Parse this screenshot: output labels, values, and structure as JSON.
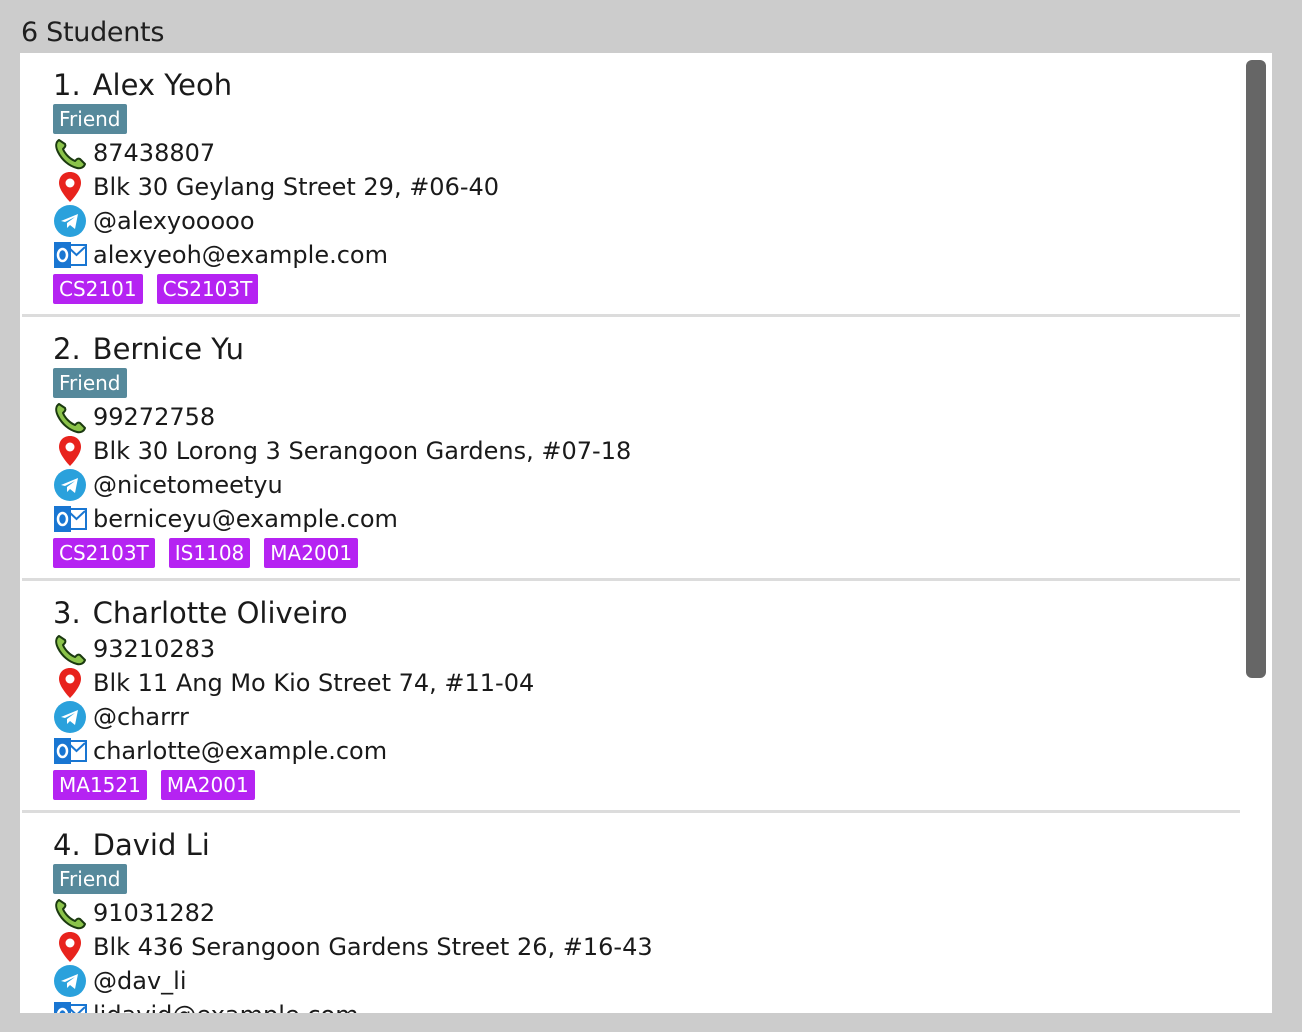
{
  "header": {
    "title": "6 Students"
  },
  "students": [
    {
      "index": "1.",
      "name": "Alex Yeoh",
      "relation": "Friend",
      "phone": "87438807",
      "address": "Blk 30 Geylang Street 29, #06-40",
      "telegram": "@alexyooooo",
      "email": "alexyeoh@example.com",
      "modules": [
        "CS2101",
        "CS2103T"
      ]
    },
    {
      "index": "2.",
      "name": "Bernice Yu",
      "relation": "Friend",
      "phone": "99272758",
      "address": "Blk 30 Lorong 3 Serangoon Gardens, #07-18",
      "telegram": "@nicetomeetyu",
      "email": "berniceyu@example.com",
      "modules": [
        "CS2103T",
        "IS1108",
        "MA2001"
      ]
    },
    {
      "index": "3.",
      "name": "Charlotte Oliveiro",
      "relation": "",
      "phone": "93210283",
      "address": "Blk 11 Ang Mo Kio Street 74, #11-04",
      "telegram": "@charrr",
      "email": "charlotte@example.com",
      "modules": [
        "MA1521",
        "MA2001"
      ]
    },
    {
      "index": "4.",
      "name": "David Li",
      "relation": "Friend",
      "phone": "91031282",
      "address": "Blk 436 Serangoon Gardens Street 26, #16-43",
      "telegram": "@dav_li",
      "email": "lidavid@example.com",
      "modules": []
    }
  ],
  "icons": {
    "phone": "phone-icon",
    "address": "location-pin-icon",
    "telegram": "telegram-icon",
    "email": "outlook-email-icon"
  },
  "colors": {
    "relation_tag": "#56899b",
    "module_tag": "#b523f2",
    "background": "#cccccc",
    "scrollbar_thumb": "#666666"
  }
}
